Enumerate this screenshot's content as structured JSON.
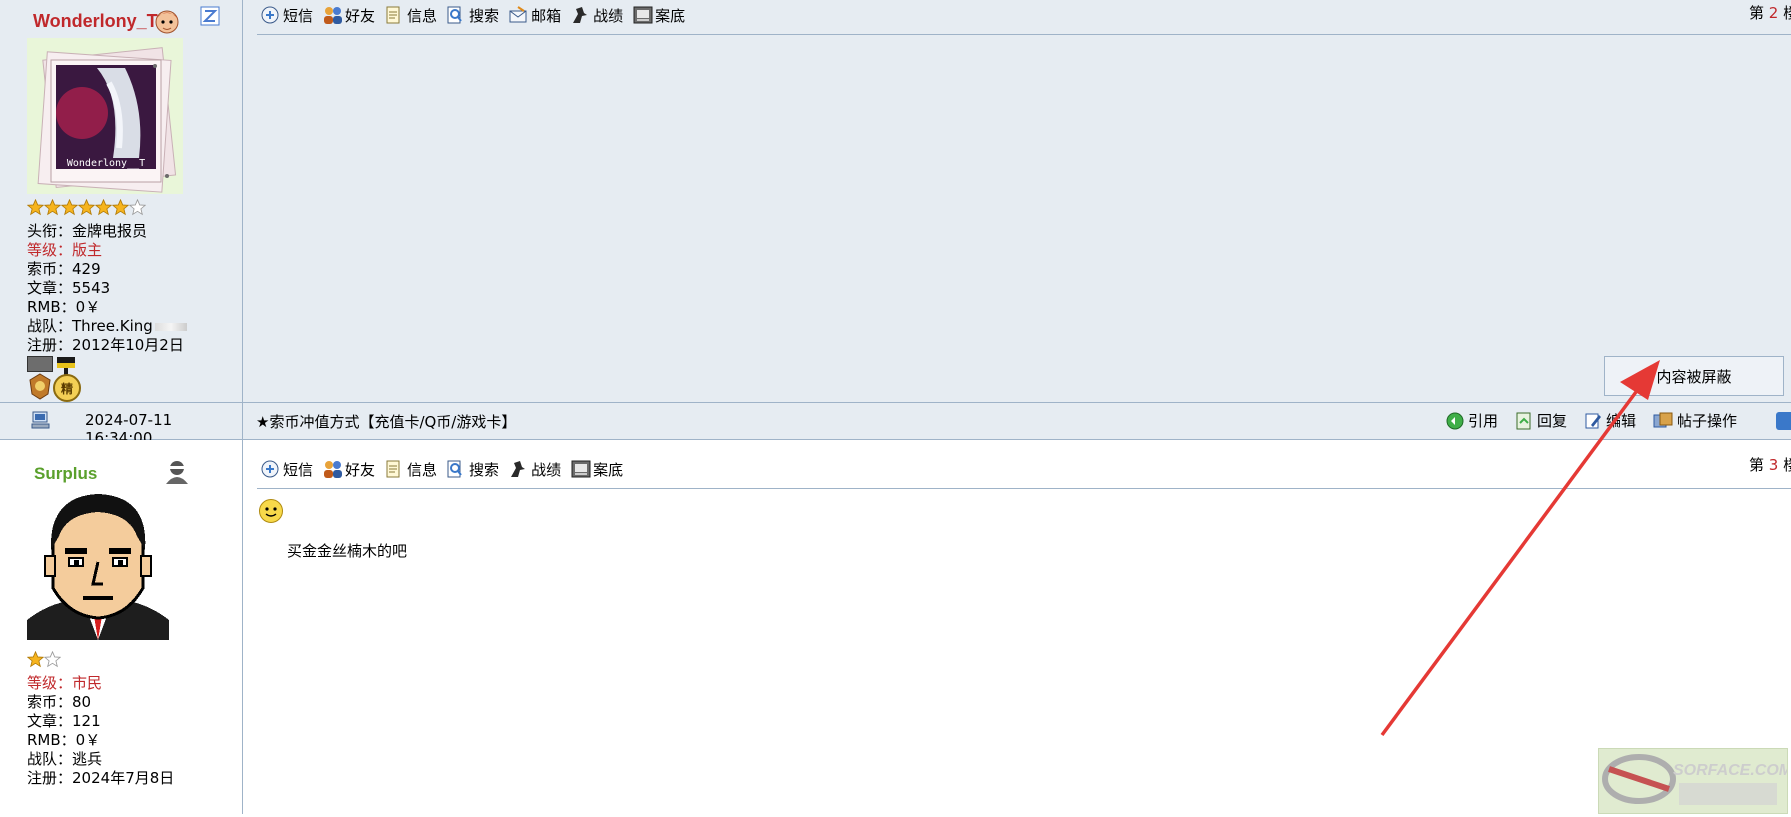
{
  "post_top": {
    "username": "Wonderlony_T",
    "avatar_caption": "Wonderlony__T",
    "stars_filled": 6,
    "stars_total": 7,
    "stats": {
      "title_label": "头衔：",
      "title_value": "金牌电报员",
      "level_label": "等级：",
      "level_value": "版主",
      "coins_label": "索币：",
      "coins_value": "429",
      "posts_label": "文章：",
      "posts_value": "5543",
      "rmb_label": "RMB：",
      "rmb_value": "0￥",
      "team_label": "战队：",
      "team_value": "Three.King",
      "reg_label": "注册：",
      "reg_value": "2012年10月2日"
    },
    "medal_text": "精",
    "toolbar": [
      "短信",
      "好友",
      "信息",
      "搜索",
      "邮箱",
      "战绩",
      "案底"
    ],
    "floor_prefix": "第",
    "floor_num": "2",
    "floor_suffix": "楼",
    "blocked_text": "内容被屏蔽"
  },
  "post_bar": {
    "timestamp": "2024-07-11 16:34:00",
    "title": "★索币冲值方式【充值卡/Q币/游戏卡】",
    "actions": [
      "引用",
      "回复",
      "编辑",
      "帖子操作"
    ]
  },
  "post_bottom": {
    "username": "Surplus",
    "stars_filled": 1,
    "stars_total": 2,
    "stats": {
      "level_label": "等级：",
      "level_value": "市民",
      "coins_label": "索币：",
      "coins_value": "80",
      "posts_label": "文章：",
      "posts_value": "121",
      "rmb_label": "RMB：",
      "rmb_value": "0￥",
      "team_label": "战队：",
      "team_value": "逃兵",
      "reg_label": "注册：",
      "reg_value": "2024年7月8日"
    },
    "toolbar": [
      "短信",
      "好友",
      "信息",
      "搜索",
      "战绩",
      "案底"
    ],
    "floor_prefix": "第",
    "floor_num": "3",
    "floor_suffix": "楼",
    "content": "买金金丝楠木的吧"
  },
  "watermark": "SORFACE.COM",
  "colors": {
    "panel_bg": "#e6ecf2",
    "border": "#9fb3c8",
    "username_red": "#c0282b",
    "username_green": "#5aa02c",
    "level_red": "#c0282b",
    "annotation_arrow": "#e53935"
  }
}
